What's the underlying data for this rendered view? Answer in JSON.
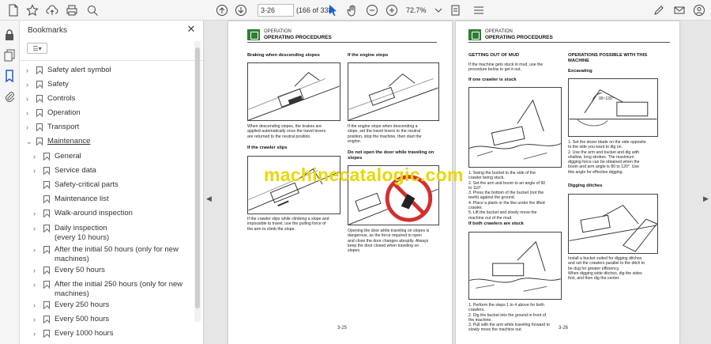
{
  "toolbar": {
    "page_value": "3-26",
    "page_count": "(166 of 338)",
    "zoom": "72.7%"
  },
  "panel": {
    "title": "Bookmarks",
    "close": "✕",
    "options": "☰▾",
    "items": [
      {
        "label": "Safety alert symbol"
      },
      {
        "label": "Safety"
      },
      {
        "label": "Controls"
      },
      {
        "label": "Operation"
      },
      {
        "label": "Transport"
      },
      {
        "label": "Maintenance"
      },
      {
        "label": "General"
      },
      {
        "label": "Service data"
      },
      {
        "label": "Safety-critical parts"
      },
      {
        "label": "Maintenance list"
      },
      {
        "label": "Walk-around inspection"
      },
      {
        "label": "Daily inspection",
        "label2": "(every 10 hours)"
      },
      {
        "label": "After the initial 50 hours (only for new",
        "label2": "machines)"
      },
      {
        "label": "Every 50 hours"
      },
      {
        "label": "After the initial 250 hours (only for new",
        "label2": "machines)"
      },
      {
        "label": "Every 250 hours"
      },
      {
        "label": "Every 500 hours"
      },
      {
        "label": "Every 1000 hours"
      }
    ]
  },
  "left_page": {
    "section": "OPERATION",
    "title": "OPERATING PROCEDURES",
    "h1": "Braking when descending slopes",
    "p1": [
      "When descending slopes, the brakes are",
      "applied automatically once the travel levers",
      "are returned to the neutral position."
    ],
    "h2": "If the crawler slips",
    "p2": [
      "If the crawler slips while climbing a slope and",
      "impossible to travel, use the pulling force of",
      "the arm to climb the slope."
    ],
    "h3": "If the engine stops",
    "p3": [
      "If the engine stops when descending a",
      "slope, set the travel levers to the neutral",
      "position, stop the machine, then start the",
      "engine."
    ],
    "h4": [
      "Do not open the door while traveling on",
      "slopes"
    ],
    "p4": [
      "Opening the door while traveling on slopes is",
      "dangerous, as the force required to open",
      "and close the door changes abruptly. Always",
      "keep the door closed when traveling on",
      "slopes."
    ],
    "page_number": "3-25"
  },
  "right_page": {
    "section": "OPERATION",
    "title": "OPERATING PROCEDURES",
    "h1": "GETTING OUT OF MUD",
    "p1": [
      "If the machine gets stuck in mud, use the",
      "procedure below to get it out."
    ],
    "h2": "If one crawler is stuck",
    "steps1": [
      "1. Swing the bucket to the side of the",
      "    crawler being stuck.",
      "2. Set the arm and boom to an angle of 90",
      "    to 110°.",
      "3. Press the bottom of the bucket (not the",
      "    teeth) against the ground.",
      "4. Place a plank or the like under the lifted",
      "    crawler.",
      "5. Lift the bucket and slowly move the",
      "    machine out of the mud."
    ],
    "h3": "If both crawlers are stuck",
    "steps2": [
      "1. Perform the steps 1 to 4 above for both",
      "    crawlers.",
      "2. Dig the bucket into the ground in front of",
      "    the machine.",
      "3. Pull with the arm while traveling forward to",
      "    slowly move the machine out."
    ],
    "h4": [
      "OPERATIONS POSSIBLE WITH THIS",
      "MACHINE"
    ],
    "h5": "Excavating",
    "angle": "90~120°",
    "p5": [
      "1. Set the dozer blade on the side opposite",
      "    to the side you want to dig on.",
      "2. Use the arm and bucket and dig with",
      "    shallow, long strokes. The maximum",
      "    digging force can be obtained when the",
      "    boom and arm angle is 80 to 120°. Use",
      "    this angle for effective digging."
    ],
    "h6": "Digging ditches",
    "p6": [
      "Install a bucket suited for digging ditches",
      "and set the crawlers parallel to the ditch to",
      "be dug for greater efficiency.",
      "When digging wide ditches, dig the sides",
      "first, and then dig the center."
    ],
    "page_number": "3-26"
  },
  "watermark": "machinecatalogic.com"
}
